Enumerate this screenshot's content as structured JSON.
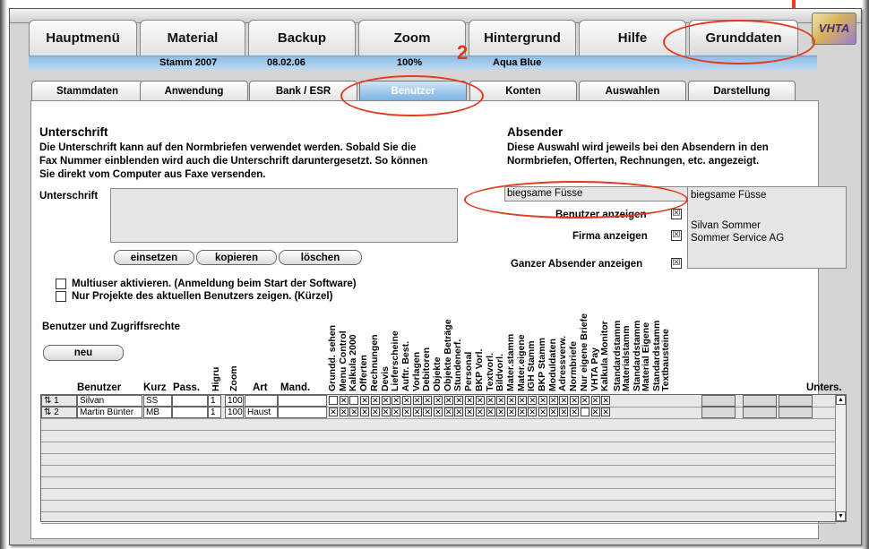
{
  "top_fragment": "g                                                                          , g",
  "main_tabs": [
    "Hauptmenü",
    "Material",
    "Backup",
    "Zoom",
    "Hintergrund",
    "Hilfe",
    "Grunddaten"
  ],
  "status": {
    "stamm": "Stamm 2007",
    "date": "08.02.06",
    "zoom": "100%",
    "background": "Aqua Blue"
  },
  "annotations": {
    "n1": "1",
    "n2": "2"
  },
  "logo_text": "VHTA",
  "sub_tabs": [
    "Stammdaten",
    "Anwendung",
    "Bank / ESR",
    "Benutzer",
    "Konten",
    "Auswahlen",
    "Darstellung"
  ],
  "signature": {
    "title": "Unterschrift",
    "desc1": "Die Unterschrift kann auf den Normbriefen verwendet werden. Sobald Sie die",
    "desc2": "Fax Nummer einblenden wird auch die Unterschrift daruntergesetzt. So können",
    "desc3": "Sie direkt vom Computer aus Faxe versenden.",
    "field_label": "Unterschrift",
    "btn_insert": "einsetzen",
    "btn_copy": "kopieren",
    "btn_delete": "löschen"
  },
  "sender": {
    "title": "Absender",
    "desc1": "Diese Auswahl wird jeweils bei den Absendern in den",
    "desc2": "Normbriefen, Offerten, Rechnungen, etc. angezeigt.",
    "input_value": "biegsame Füsse",
    "show_user": "Benutzer anzeigen",
    "show_company": "Firma anzeigen",
    "show_full": "Ganzer Absender anzeigen",
    "preview_line1": "biegsame Füsse",
    "preview_line2": "Silvan Sommer",
    "preview_line3": "Sommer Service AG"
  },
  "options": {
    "multiuser": "Multiuser aktivieren. (Anmeldung beim Start der Software)",
    "projects_only": "Nur Projekte des aktuellen Benutzers zeigen. (Kürzel)"
  },
  "users": {
    "title": "Benutzer und Zugriffsrechte",
    "btn_new": "neu",
    "col_user": "Benutzer",
    "col_kurz": "Kurz",
    "col_pass": "Pass.",
    "col_higru": "Higru",
    "col_zoom": "Zoom",
    "col_art": "Art",
    "col_mand": "Mand.",
    "col_unters": "Unters.",
    "rights": [
      "Grundd. sehen",
      "Menu Control",
      "Kalkula 2000",
      "Offerten",
      "Rechnungen",
      "Devis",
      "Lieferscheine",
      "Auftr. Best.",
      "Vorlagen",
      "Debitoren",
      "Objekte",
      "Objekte Beträge",
      "Stundenerf.",
      "Personal",
      "BKP Vorl.",
      "Textvorl.",
      "Bildvorl.",
      "Mater.stamm",
      "Mater.eigene",
      "IGH Stamm",
      "BKP Stamm",
      "Moduldaten",
      "Adressverw.",
      "Normbriefe",
      "Nur eigene Briefe",
      "VHTA Pay",
      "Kalkula Monitor",
      "Standardstamm Materialstamm",
      "Standardstamm Material Eigene",
      "Standardstamm Textbausteine"
    ],
    "rows": [
      {
        "num": "1",
        "name": "Silvan",
        "kurz": "SS",
        "higru": "1",
        "zoom": "100",
        "art": "",
        "checks": "☐☒☐☒☒☒☒☒☒☒☒☒☒☒☒☒☒☒☒☒☒☒☒☒☒☒☒"
      },
      {
        "num": "2",
        "name": "Martin Bünter",
        "kurz": "MB",
        "higru": "1",
        "zoom": "100",
        "art": "Haust",
        "checks": "☒☒☒☒☒☒☒☒☒☒☒☒☒☒☒☒☒☒☒☒☒☒☒☒☐☒☒"
      }
    ]
  }
}
